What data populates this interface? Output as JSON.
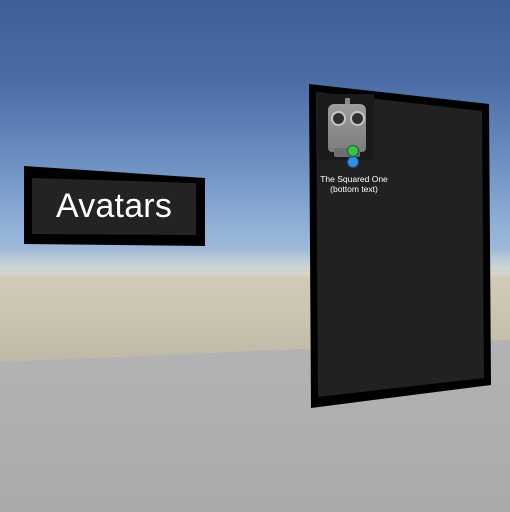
{
  "title_panel": {
    "label": "Avatars"
  },
  "avatar_list": {
    "items": [
      {
        "name": "The Squared One",
        "subtitle": "(bottom text)"
      }
    ]
  },
  "colors": {
    "sky_top": "#3f5f96",
    "sky_bottom": "#a9c1d9",
    "sand": "#c7c1ad",
    "floor": "#b3b3b3",
    "panel_border": "#000000",
    "panel_fill": "#212121",
    "text": "#ffffff",
    "badge_green": "#39c24b",
    "badge_blue": "#2f8fe0"
  },
  "icons": [
    "robot-avatar-icon",
    "green-status-icon",
    "blue-status-icon"
  ]
}
